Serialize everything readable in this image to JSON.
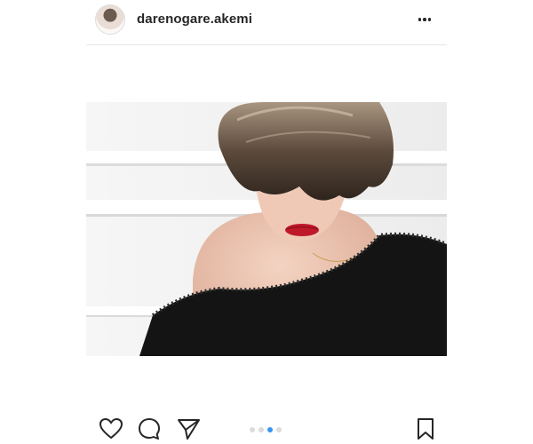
{
  "post": {
    "username": "darenogare.akemi",
    "more_icon": "more-horizontal-icon"
  },
  "carousel": {
    "slide_count": 4,
    "active_index": 2,
    "active_color": "#3897f0",
    "inactive_color": "#dbdbdb"
  },
  "actions": {
    "like_icon": "heart-icon",
    "comment_icon": "comment-icon",
    "share_icon": "paper-plane-icon",
    "save_icon": "bookmark-icon"
  }
}
